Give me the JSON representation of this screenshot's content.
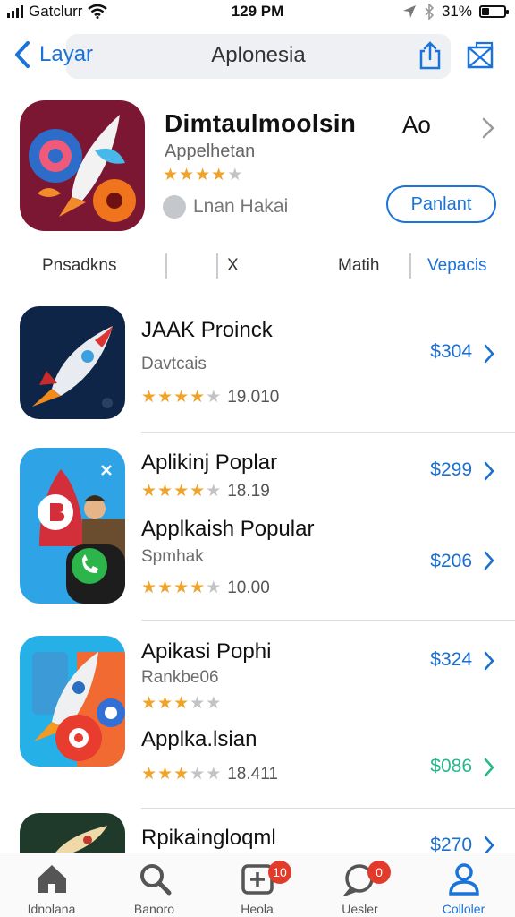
{
  "status_bar": {
    "carrier": "Gatclurr",
    "time": "129 PM",
    "battery": "31%",
    "battery_level": 0.31
  },
  "nav": {
    "back_label": "Layar",
    "title": "Aplonesia"
  },
  "featured": {
    "name": "Dimtaulmoolsin",
    "badge": "Ao",
    "developer": "Appelhetan",
    "stars_filled": 4,
    "meta": "Lnan Hakai",
    "get_label": "Panlant"
  },
  "filters": [
    "Pnsadkns",
    "X",
    "Matih",
    "Vepacis"
  ],
  "apps": [
    {
      "title": "JAAK Proinck",
      "subtitle": "Davtcais",
      "stars": 4,
      "rating_value": "19.010",
      "price": "$304"
    },
    {
      "title": "Aplikinj Poplar",
      "stars": 4,
      "rating_value": "18.19",
      "price": "$299"
    },
    {
      "title": "Applkaish Popular",
      "subtitle": "Spmhak",
      "stars": 4,
      "rating_value": "10.00",
      "price": "$206"
    },
    {
      "title": "Apikasi Pophi",
      "subtitle": "Rankbe06",
      "stars": 3,
      "price": "$324"
    },
    {
      "title": "Applka.lsian",
      "stars": 3,
      "rating_value": "18.411",
      "price": "$086"
    },
    {
      "title": "Rpikaingloqml",
      "price": "$270"
    }
  ],
  "tabs": [
    {
      "label": "Idnolana",
      "icon": "home-icon"
    },
    {
      "label": "Banoro",
      "icon": "search-icon"
    },
    {
      "label": "Heola",
      "icon": "add-square-icon",
      "badge": "10"
    },
    {
      "label": "Uesler",
      "icon": "chat-bubble-icon",
      "badge": "0"
    },
    {
      "label": "Colloler",
      "icon": "person-icon"
    }
  ],
  "colors": {
    "accent": "#1a73d9",
    "star": "#f0a32b",
    "price_green": "#26b88a",
    "badge": "#e23b2b"
  }
}
